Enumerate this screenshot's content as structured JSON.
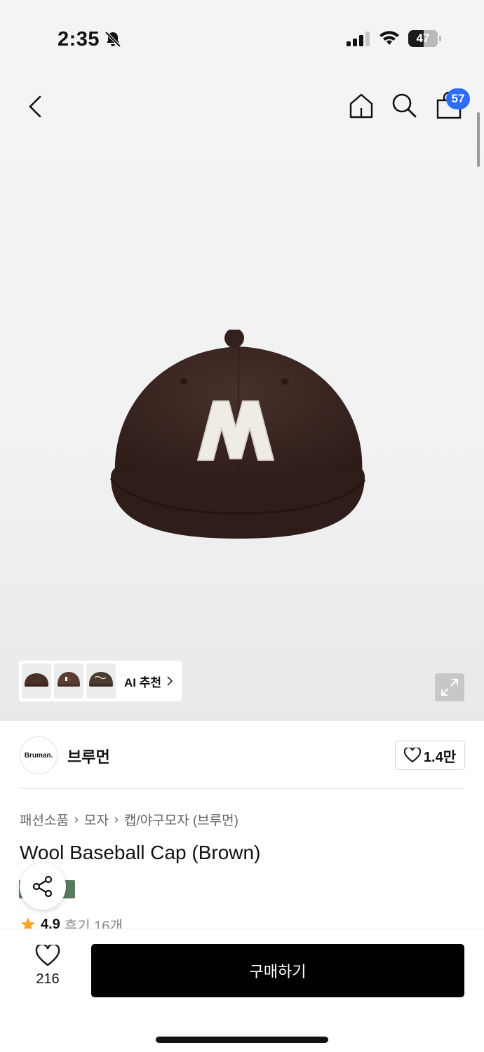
{
  "status_bar": {
    "time": "2:35",
    "battery": "47",
    "icons": [
      "bell-slash-icon",
      "signal-icon",
      "wifi-icon",
      "battery-icon"
    ]
  },
  "nav": {
    "icons": [
      "back-chevron-icon",
      "home-icon",
      "search-icon",
      "shopping-bag-icon"
    ],
    "cart_count": "57"
  },
  "hero": {
    "ai_recommend_label": "AI 추천",
    "expand_icon": "expand-icon",
    "thumbnails": [
      "cap-thumbnail-1",
      "cap-thumbnail-2",
      "cap-thumbnail-3"
    ],
    "cap_color": "#3a241f",
    "letter_color": "#efece6"
  },
  "brand": {
    "logo_text": "Bruman.",
    "name": "브루먼",
    "likes": "1.4만"
  },
  "product": {
    "breadcrumb": [
      "패션소품",
      "모자",
      "캡/야구모자 (브루먼)"
    ],
    "title": "Wool Baseball Cap (Brown)",
    "rating": "4.9",
    "reviews": "후기 16개"
  },
  "bottom_bar": {
    "wish_count": "216",
    "buy_label": "구매하기"
  },
  "colors": {
    "accent_badge": "#2d6cf5",
    "buy_button": "#000000",
    "star": "#f5a623"
  }
}
